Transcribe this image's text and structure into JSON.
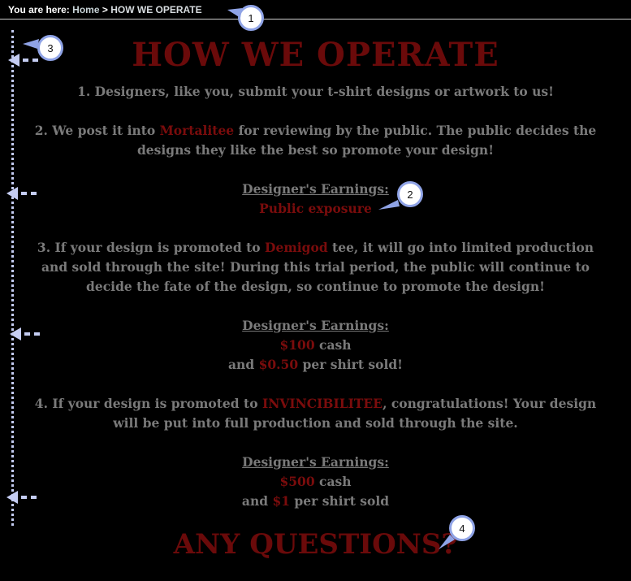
{
  "breadcrumb": {
    "prefix": "You are here:",
    "home": "Home",
    "separator": ">",
    "current": "HOW WE OPERATE"
  },
  "title": "HOW WE OPERATE",
  "steps": {
    "s1": "1. Designers, like you, submit your t-shirt designs or artwork to us!",
    "s2_pre": "2. We post it into ",
    "s2_hl": "Mortalitee",
    "s2_post": " for reviewing by the public. The public decides the designs they like the best so promote your design!",
    "s3_pre": "3. If your design is promoted to ",
    "s3_hl": "Demigod",
    "s3_post": " tee, it will go into limited production and sold through the site! During this trial period, the public will continue to decide the fate of the design, so continue to promote the design!",
    "s4_pre": "4. If your design is promoted to ",
    "s4_hl": "INVINCIBILITEE",
    "s4_post": ", congratulations! Your design will be put into full production and sold through the site."
  },
  "earnings": {
    "heading": "Designer's Earnings:",
    "e1": "Public exposure",
    "e2_amount": "$100",
    "e2_label": " cash",
    "e2_and": "and ",
    "e2_per": "$0.50",
    "e2_rest": " per shirt sold!",
    "e3_amount": "$500",
    "e3_label": " cash",
    "e3_and": "and ",
    "e3_per": "$1",
    "e3_rest": " per shirt sold"
  },
  "questions": "ANY QUESTIONS?",
  "callouts": [
    "1",
    "2",
    "3",
    "4"
  ],
  "colors": {
    "accent": "#7a0c0c",
    "callout_border": "#8fa3e6",
    "guide": "#c4ccf2"
  },
  "icons": [
    "dashed-left-arrow-icon",
    "dotted-guide-line"
  ]
}
